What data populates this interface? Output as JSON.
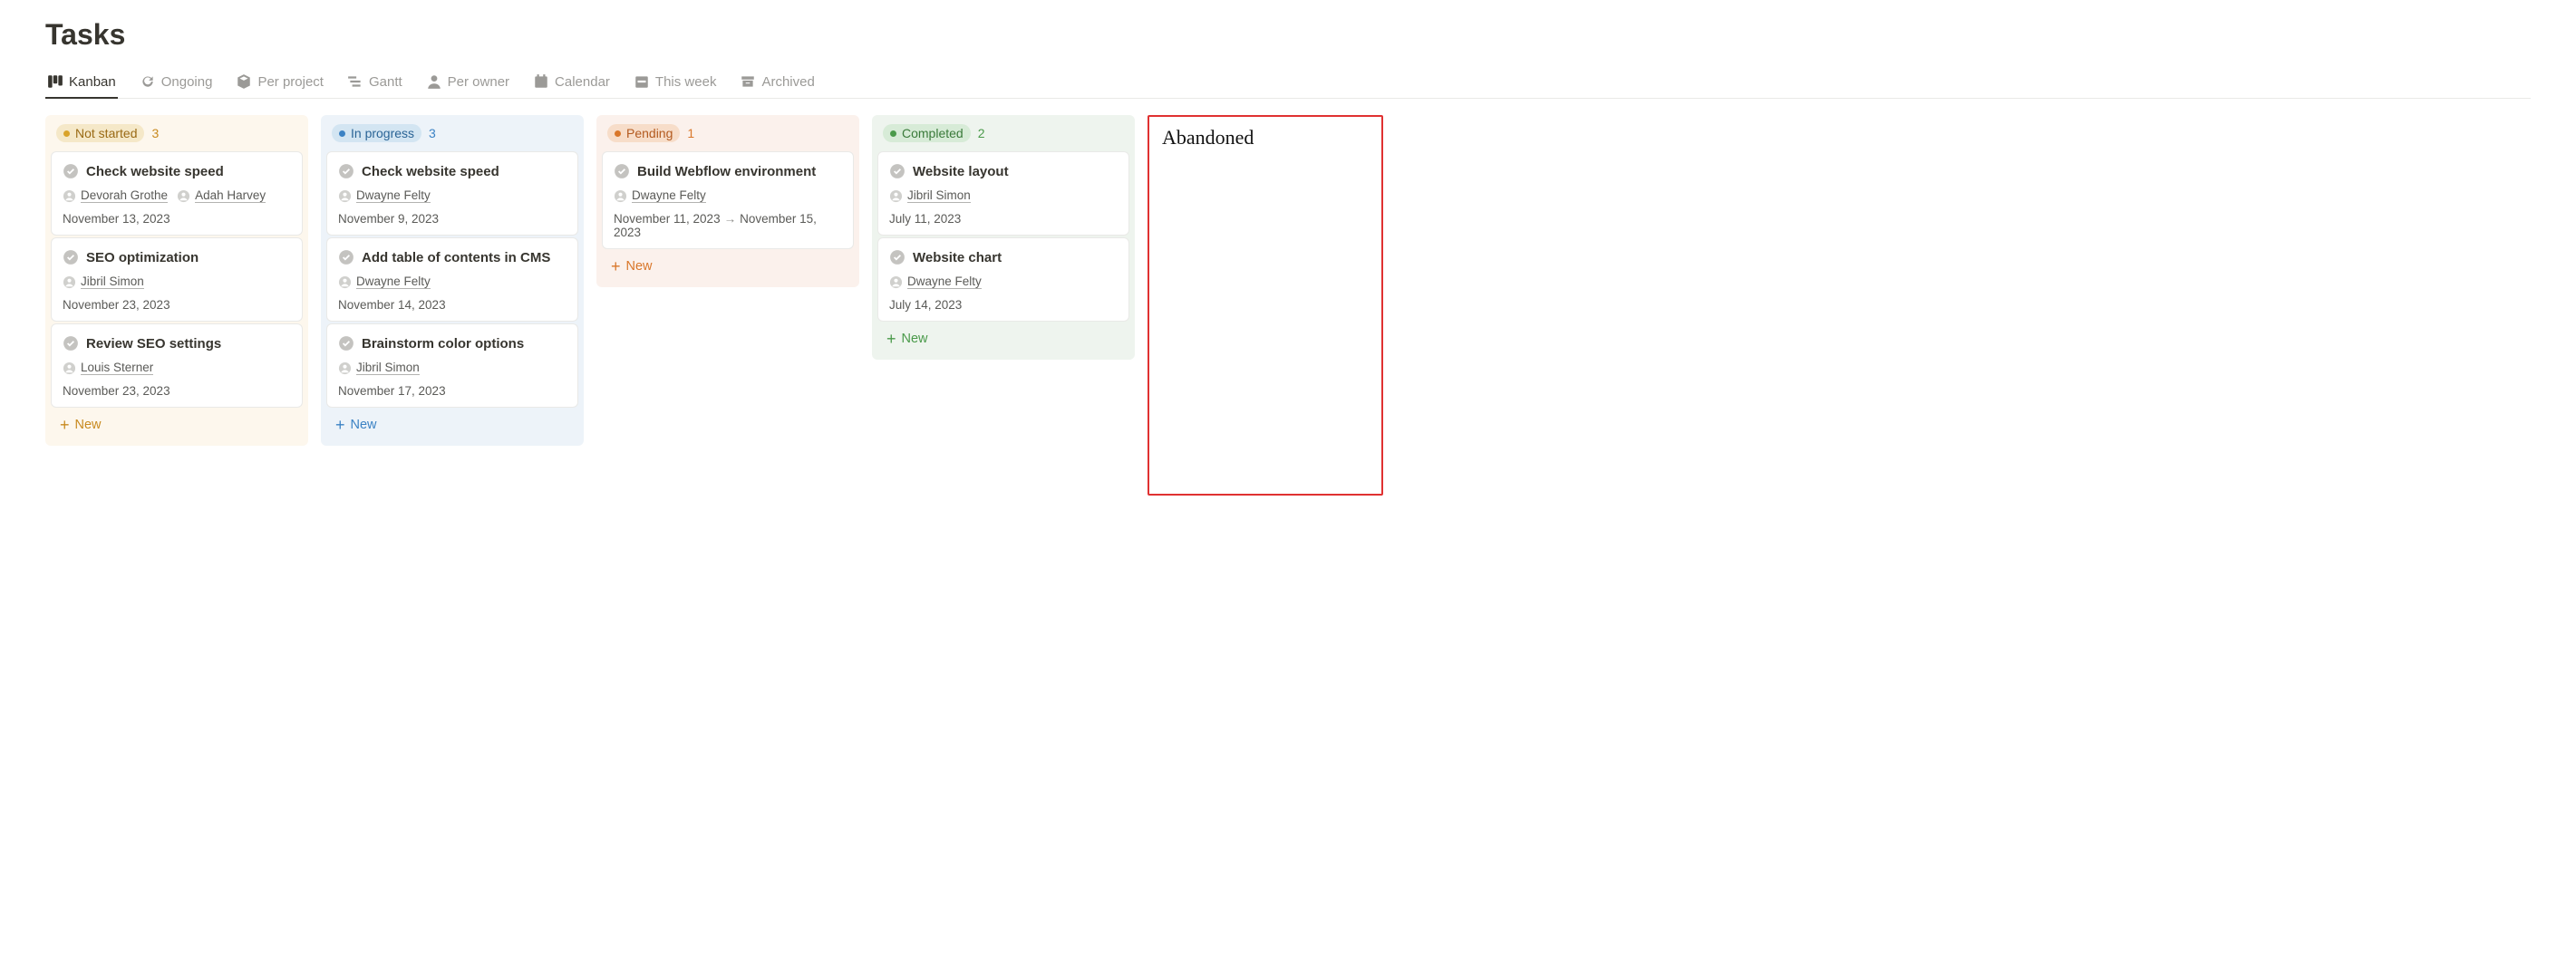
{
  "page_title": "Tasks",
  "tabs": [
    {
      "label": "Kanban",
      "active": true
    },
    {
      "label": "Ongoing",
      "active": false
    },
    {
      "label": "Per project",
      "active": false
    },
    {
      "label": "Gantt",
      "active": false
    },
    {
      "label": "Per owner",
      "active": false
    },
    {
      "label": "Calendar",
      "active": false
    },
    {
      "label": "This week",
      "active": false
    },
    {
      "label": "Archived",
      "active": false
    }
  ],
  "columns": {
    "not_started": {
      "label": "Not started",
      "count": "3",
      "new_label": "New",
      "cards": [
        {
          "title": "Check website speed",
          "owners": [
            "Devorah Grothe",
            "Adah Harvey"
          ],
          "date": "November 13, 2023"
        },
        {
          "title": "SEO optimization",
          "owners": [
            "Jibril Simon"
          ],
          "date": "November 23, 2023"
        },
        {
          "title": "Review SEO settings",
          "owners": [
            "Louis Sterner"
          ],
          "date": "November 23, 2023"
        }
      ]
    },
    "in_progress": {
      "label": "In progress",
      "count": "3",
      "new_label": "New",
      "cards": [
        {
          "title": "Check website speed",
          "owners": [
            "Dwayne Felty"
          ],
          "date": "November 9, 2023"
        },
        {
          "title": "Add table of contents in CMS",
          "owners": [
            "Dwayne Felty"
          ],
          "date": "November 14, 2023"
        },
        {
          "title": "Brainstorm color options",
          "owners": [
            "Jibril Simon"
          ],
          "date": "November 17, 2023"
        }
      ]
    },
    "pending": {
      "label": "Pending",
      "count": "1",
      "new_label": "New",
      "cards": [
        {
          "title": "Build Webflow environment",
          "owners": [
            "Dwayne Felty"
          ],
          "date_start": "November 11, 2023",
          "date_end": "November 15, 2023"
        }
      ]
    },
    "completed": {
      "label": "Completed",
      "count": "2",
      "new_label": "New",
      "cards": [
        {
          "title": "Website layout",
          "owners": [
            "Jibril Simon"
          ],
          "date": "July 11, 2023"
        },
        {
          "title": "Website chart",
          "owners": [
            "Dwayne Felty"
          ],
          "date": "July 14, 2023"
        }
      ]
    },
    "abandoned": {
      "label": "Abandoned"
    }
  }
}
